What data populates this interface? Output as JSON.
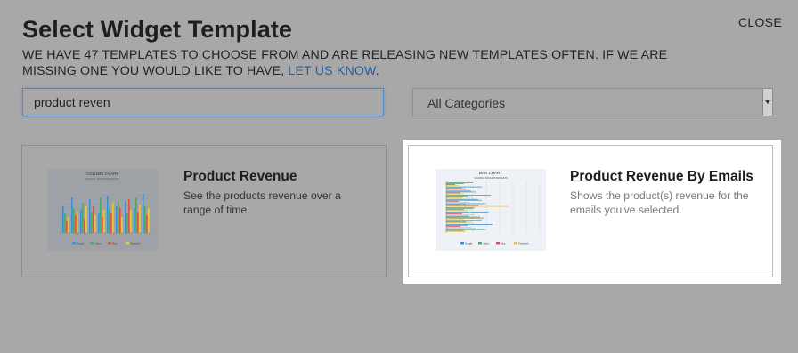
{
  "header": {
    "title": "Select Widget Template",
    "close_label": "CLOSE",
    "subtitle": "WE HAVE 47 TEMPLATES TO CHOOSE FROM AND ARE RELEASING NEW TEMPLATES OFTEN. IF WE ARE MISSING ONE YOU WOULD LIKE TO HAVE, ",
    "link_label": "LET US KNOW",
    "link_suffix": "."
  },
  "filters": {
    "search_value": "product reven",
    "category_selected": "All Categories"
  },
  "templates": [
    {
      "title": "Product Revenue",
      "description": "See the products revenue over a range of time.",
      "thumbnail": {
        "chart_type": "column",
        "title": "COLUMN CHART",
        "subtitle": "SOURCE: WIDGETS/WIDGETS",
        "legend": [
          "Google",
          "Yahoo",
          "Bing",
          "Facebook"
        ]
      }
    },
    {
      "title": "Product Revenue By Emails",
      "description": "Shows the product(s) revenue for the emails you've selected.",
      "selected": true,
      "thumbnail": {
        "chart_type": "bar",
        "title": "BAR CHART",
        "subtitle": "SOURCE: WIDGETS/WIDGETS",
        "legend": [
          "Google",
          "Yahoo",
          "Bing",
          "Facebook"
        ]
      }
    }
  ],
  "colors": {
    "overlay": "#a8a8a8",
    "link": "#1f5fa8",
    "focus": "#4f86c6",
    "series": [
      "#3a8fd6",
      "#4aa868",
      "#d9534f",
      "#e8c840"
    ]
  }
}
